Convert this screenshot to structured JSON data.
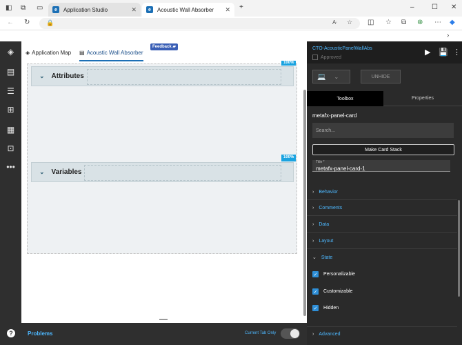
{
  "browser": {
    "tabs": [
      {
        "label": "Application Studio"
      },
      {
        "label": "Acoustic Wall Absorber"
      }
    ],
    "new_tab": "+",
    "close": "✕",
    "min": "–",
    "max": "☐"
  },
  "editor": {
    "tabs": [
      {
        "label": "Application Map"
      },
      {
        "label": "Acoustic Wall Absorber"
      }
    ],
    "feedback": "Feedback",
    "cards": [
      {
        "title": "Attributes",
        "percent": "100%"
      },
      {
        "title": "Variables",
        "percent": "100%"
      }
    ]
  },
  "bottom": {
    "problems": "Problems",
    "current_tab_only": "Current Tab Only"
  },
  "right_panel": {
    "component_name": "CTO-AcousticPanelWallAbs",
    "approved_label": "Approved",
    "unhide": "UNHIDE",
    "tabs": {
      "toolbox": "Toolbox",
      "properties": "Properties"
    },
    "selected": "metafx-panel-card",
    "search_placeholder": "Search...",
    "make_card_stack": "Make Card Stack",
    "title_label": "Title *",
    "title_value": "metafx-panel-card-1",
    "sections": [
      "Behavior",
      "Comments",
      "Data",
      "Layout",
      "State"
    ],
    "state_options": [
      {
        "label": "Personalizable",
        "checked": true
      },
      {
        "label": "Customizable",
        "checked": true
      },
      {
        "label": "Hidden",
        "checked": true
      }
    ],
    "advanced": "Advanced"
  },
  "colors": {
    "accent": "#1b6fb5",
    "link": "#4db8ff",
    "badge": "#1aa3e0"
  }
}
